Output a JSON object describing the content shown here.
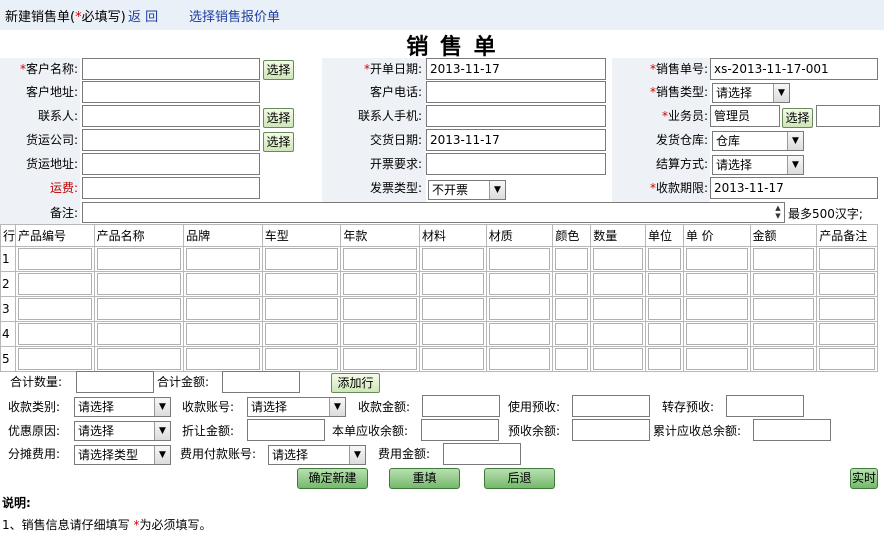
{
  "header": {
    "title_prefix": "新建销售单(",
    "title_star": "*",
    "title_suffix": "必填写)",
    "back_link": "返 回",
    "quote_link": "选择销售报价单"
  },
  "form_title": "销 售 单",
  "fields": {
    "customer_name_label": "客户名称:",
    "customer_address_label": "客户地址:",
    "contact_label": "联系人:",
    "shipping_company_label": "货运公司:",
    "shipping_address_label": "货运地址:",
    "freight_label": "运费:",
    "note_label": "备注:",
    "order_date_label": "开单日期:",
    "order_date_value": "2013-11-17",
    "customer_phone_label": "客户电话:",
    "contact_mobile_label": "联系人手机:",
    "delivery_date_label": "交货日期:",
    "delivery_date_value": "2013-11-17",
    "invoice_req_label": "开票要求:",
    "invoice_type_label": "发票类型:",
    "invoice_type_value": "不开票",
    "sales_no_label": "销售单号:",
    "sales_no_value": "xs-2013-11-17-001",
    "sales_type_label": "销售类型:",
    "sales_type_value": "请选择",
    "salesman_label": "业务员:",
    "salesman_value": "管理员",
    "warehouse_label": "发货仓库:",
    "warehouse_value": "仓库",
    "settlement_label": "结算方式:",
    "settlement_value": "请选择",
    "due_date_label": "收款期限:",
    "due_date_value": "2013-11-17",
    "note_hint": "最多500汉字;",
    "select_label": "选择",
    "required_star": "*"
  },
  "table": {
    "headers": [
      "行",
      "产品编号",
      "产品名称",
      "品牌",
      "车型",
      "年款",
      "材料",
      "材质",
      "颜色",
      "数量",
      "单位",
      "单 价",
      "金额",
      "产品备注"
    ],
    "rows": [
      "1",
      "2",
      "3",
      "4",
      "5"
    ]
  },
  "summary": {
    "total_qty_label": "合计数量:",
    "total_amount_label": "合计金额:",
    "add_row_label": "添加行",
    "receipt_type_label": "收款类别:",
    "receipt_type_value": "请选择",
    "account_label": "收款账号:",
    "account_value": "请选择",
    "receipt_amount_label": "收款金额:",
    "use_prepay_label": "使用预收:",
    "transfer_prepay_label": "转存预收:",
    "discount_reason_label": "优惠原因:",
    "discount_reason_value": "请选择",
    "discount_amount_label": "折让金额:",
    "receivable_label": "本单应收余额:",
    "prepay_balance_label": "预收余额:",
    "total_receivable_label": "累计应收总余额:",
    "share_cost_label": "分摊费用:",
    "share_cost_value": "请选择类型",
    "cost_account_label": "费用付款账号:",
    "cost_account_value": "请选择",
    "cost_amount_label": "费用金额:"
  },
  "actions": {
    "confirm_label": "确定新建",
    "reset_label": "重填",
    "back_label": "后退",
    "realtime_label": "实时"
  },
  "notes": {
    "heading": "说明:",
    "line1_prefix": "1、销售信息请仔细填写 ",
    "line1_star": "*",
    "line1_suffix": "为必须填写。"
  }
}
